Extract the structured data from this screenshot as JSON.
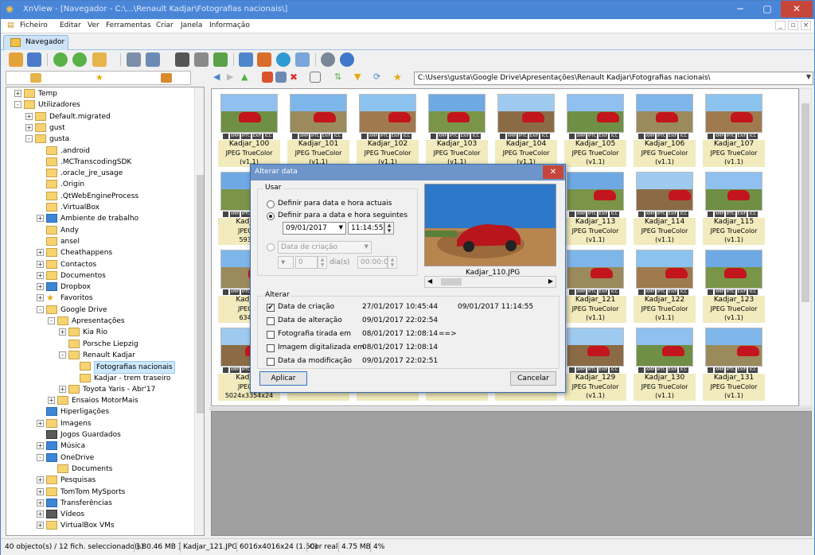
{
  "window": {
    "title": "XnView - [Navegador - C:\\...\\Renault Kadjar\\Fotografias nacionais\\]"
  },
  "menu": [
    "Ficheiro",
    "Editar",
    "Ver",
    "Ferramentas",
    "Criar",
    "Janela",
    "Informação"
  ],
  "tab": {
    "label": "Navegador"
  },
  "address": {
    "path": "C:\\Users\\gusta\\Google Drive\\Apresentações\\Renault Kadjar\\Fotografias nacionais\\"
  },
  "tree": [
    {
      "label": "Temp",
      "lvl": 2,
      "exp": "+"
    },
    {
      "label": "Utilizadores",
      "lvl": 2,
      "exp": "-"
    },
    {
      "label": "Default.migrated",
      "lvl": 3,
      "exp": "+"
    },
    {
      "label": "gust",
      "lvl": 3,
      "exp": "+"
    },
    {
      "label": "gusta",
      "lvl": 3,
      "exp": "-"
    },
    {
      "label": ".android",
      "lvl": 4,
      "exp": ""
    },
    {
      "label": ".MCTranscodingSDK",
      "lvl": 4,
      "exp": ""
    },
    {
      "label": ".oracle_jre_usage",
      "lvl": 4,
      "exp": ""
    },
    {
      "label": ".Origin",
      "lvl": 4,
      "exp": ""
    },
    {
      "label": ".QtWebEngineProcess",
      "lvl": 4,
      "exp": ""
    },
    {
      "label": ".VirtualBox",
      "lvl": 4,
      "exp": ""
    },
    {
      "label": "Ambiente de trabalho",
      "lvl": 4,
      "exp": "+",
      "icon": "blue"
    },
    {
      "label": "Andy",
      "lvl": 4,
      "exp": ""
    },
    {
      "label": "ansel",
      "lvl": 4,
      "exp": ""
    },
    {
      "label": "Cheathappens",
      "lvl": 4,
      "exp": "+"
    },
    {
      "label": "Contactos",
      "lvl": 4,
      "exp": "+"
    },
    {
      "label": "Documentos",
      "lvl": 4,
      "exp": "+"
    },
    {
      "label": "Dropbox",
      "lvl": 4,
      "exp": "+",
      "icon": "blue"
    },
    {
      "label": "Favoritos",
      "lvl": 4,
      "exp": "+",
      "icon": "star"
    },
    {
      "label": "Google Drive",
      "lvl": 4,
      "exp": "-"
    },
    {
      "label": "Apresentações",
      "lvl": 5,
      "exp": "-"
    },
    {
      "label": "Kia Rio",
      "lvl": 6,
      "exp": "+"
    },
    {
      "label": "Porsche Liepzig",
      "lvl": 6,
      "exp": ""
    },
    {
      "label": "Renault Kadjar",
      "lvl": 6,
      "exp": "-"
    },
    {
      "label": "Fotografias nacionais",
      "lvl": 7,
      "exp": "",
      "sel": true
    },
    {
      "label": "Kadjar - trem traseiro",
      "lvl": 7,
      "exp": ""
    },
    {
      "label": "Toyota Yaris - Abr'17",
      "lvl": 6,
      "exp": "+"
    },
    {
      "label": "Ensaios MotorMais",
      "lvl": 5,
      "exp": "+"
    },
    {
      "label": "Hiperligações",
      "lvl": 4,
      "exp": "",
      "icon": "blue"
    },
    {
      "label": "Imagens",
      "lvl": 4,
      "exp": "+"
    },
    {
      "label": "Jogos Guardados",
      "lvl": 4,
      "exp": "",
      "icon": "dark"
    },
    {
      "label": "Música",
      "lvl": 4,
      "exp": "+",
      "icon": "blue"
    },
    {
      "label": "OneDrive",
      "lvl": 4,
      "exp": "-",
      "icon": "blue"
    },
    {
      "label": "Documents",
      "lvl": 5,
      "exp": ""
    },
    {
      "label": "Pesquisas",
      "lvl": 4,
      "exp": "+"
    },
    {
      "label": "TomTom MySports",
      "lvl": 4,
      "exp": "+"
    },
    {
      "label": "Transferências",
      "lvl": 4,
      "exp": "+",
      "icon": "blue"
    },
    {
      "label": "Vídeos",
      "lvl": 4,
      "exp": "+",
      "icon": "dark"
    },
    {
      "label": "VirtualBox VMs",
      "lvl": 4,
      "exp": "+"
    }
  ],
  "thumbs": [
    {
      "name": "Kadjar_100",
      "type": "JPEG TrueColor (v1.1)",
      "dims": "7360x4912x24"
    },
    {
      "name": "Kadjar_101",
      "type": "JPEG TrueColor (v1.1)",
      "dims": "7360x4912x24"
    },
    {
      "name": "Kadjar_102",
      "type": "JPEG TrueColor (v1.1)",
      "dims": "7360x4912x24"
    },
    {
      "name": "Kadjar_103",
      "type": "JPEG TrueColor (v1.1)",
      "dims": "6360x4245x24"
    },
    {
      "name": "Kadjar_104",
      "type": "JPEG TrueColor (v1.1)",
      "dims": "6962x4646x24"
    },
    {
      "name": "Kadjar_105",
      "type": "JPEG TrueColor (v1.1)",
      "dims": "5160x3444x24"
    },
    {
      "name": "Kadjar_106",
      "type": "JPEG TrueColor (v1.1)",
      "dims": "4144x2765x24"
    },
    {
      "name": "Kadjar_107",
      "type": "JPEG TrueColor (v1.1)",
      "dims": "7360x4912x24"
    },
    {
      "name": "Kadjar_",
      "type": "JPEG Tr",
      "dims": "5937x"
    },
    {
      "name": "",
      "type": "",
      "dims": ""
    },
    {
      "name": "",
      "type": "",
      "dims": ""
    },
    {
      "name": "",
      "type": "",
      "dims": ""
    },
    {
      "name": "",
      "type": "",
      "dims": ""
    },
    {
      "name": "Kadjar_113",
      "type": "JPEG TrueColor (v1.1)",
      "dims": "7047x4703x24"
    },
    {
      "name": "Kadjar_114",
      "type": "JPEG TrueColor (v1.1)",
      "dims": "7360x4912x24"
    },
    {
      "name": "Kadjar_115",
      "type": "JPEG TrueColor (v1.1)",
      "dims": "7360x4912x24"
    },
    {
      "name": "Kadjar_",
      "type": "JPEG Tr",
      "dims": "6349x"
    },
    {
      "name": "",
      "type": "",
      "dims": ""
    },
    {
      "name": "",
      "type": "",
      "dims": ""
    },
    {
      "name": "",
      "type": "",
      "dims": ""
    },
    {
      "name": "",
      "type": "",
      "dims": ""
    },
    {
      "name": "Kadjar_121",
      "type": "JPEG TrueColor (v1.1)",
      "dims": "6016x4016x24"
    },
    {
      "name": "Kadjar_122",
      "type": "JPEG TrueColor (v1.1)",
      "dims": "4539x3030x24"
    },
    {
      "name": "Kadjar_123",
      "type": "JPEG TrueColor (v1.1)",
      "dims": "4692x3132x24"
    },
    {
      "name": "Kadjar_",
      "type": "JPEG Tr",
      "dims": "5024x3354x24"
    },
    {
      "name": "",
      "type": "",
      "dims": "6016x4016x24"
    },
    {
      "name": "",
      "type": "",
      "dims": "5389x3596x24"
    },
    {
      "name": "",
      "type": "",
      "dims": "5504x3674x24"
    },
    {
      "name": "",
      "type": "",
      "dims": ""
    },
    {
      "name": "Kadjar_129",
      "type": "JPEG TrueColor (v1.1)",
      "dims": "5387x3596x24"
    },
    {
      "name": "Kadjar_130",
      "type": "JPEG TrueColor (v1.1)",
      "dims": "6016x4016x24"
    },
    {
      "name": "Kadjar_131",
      "type": "JPEG TrueColor (v1.1)",
      "dims": "5134x3428x24"
    }
  ],
  "badges": [
    "XMP",
    "IPTC",
    "EXIF",
    "ICC"
  ],
  "status": {
    "count": "40 objecto(s) / 12 fich. seleccionado(s)",
    "size": "[ 80.46 MB ]",
    "file": "Kadjar_121.JPG",
    "dims": "6016x4016x24 (1.50)",
    "color": "Cor real",
    "mem": "4.75 MB",
    "zoom": "4%"
  },
  "dialog": {
    "title": "Alterar data",
    "use_label": "Usar",
    "opt1": "Definir para data e hora actuais",
    "opt2": "Definir para a data e hora seguintes",
    "date": "09/01/2017",
    "time": "11:14:55",
    "creation_select": "Data de criação",
    "days": "0",
    "days_label": "dia(s)",
    "time2": "00:00:00",
    "preview_name": "Kadjar_110.JPG",
    "change_label": "Alterar",
    "rows": [
      {
        "label": "Data de criação",
        "checked": true,
        "old": "27/01/2017 10:45:44",
        "new": "09/01/2017 11:14:55"
      },
      {
        "label": "Data de alteração",
        "checked": false,
        "old": "09/01/2017 22:02:54",
        "new": ""
      },
      {
        "label": "Fotografia tirada em",
        "checked": false,
        "old": "08/01/2017 12:08:14",
        "new": "==>"
      },
      {
        "label": "Imagem digitalizada em",
        "checked": false,
        "old": "08/01/2017 12:08:14",
        "new": ""
      },
      {
        "label": "Data da modificação",
        "checked": false,
        "old": "09/01/2017 22:02:51",
        "new": ""
      }
    ],
    "apply": "Aplicar",
    "cancel": "Cancelar"
  }
}
